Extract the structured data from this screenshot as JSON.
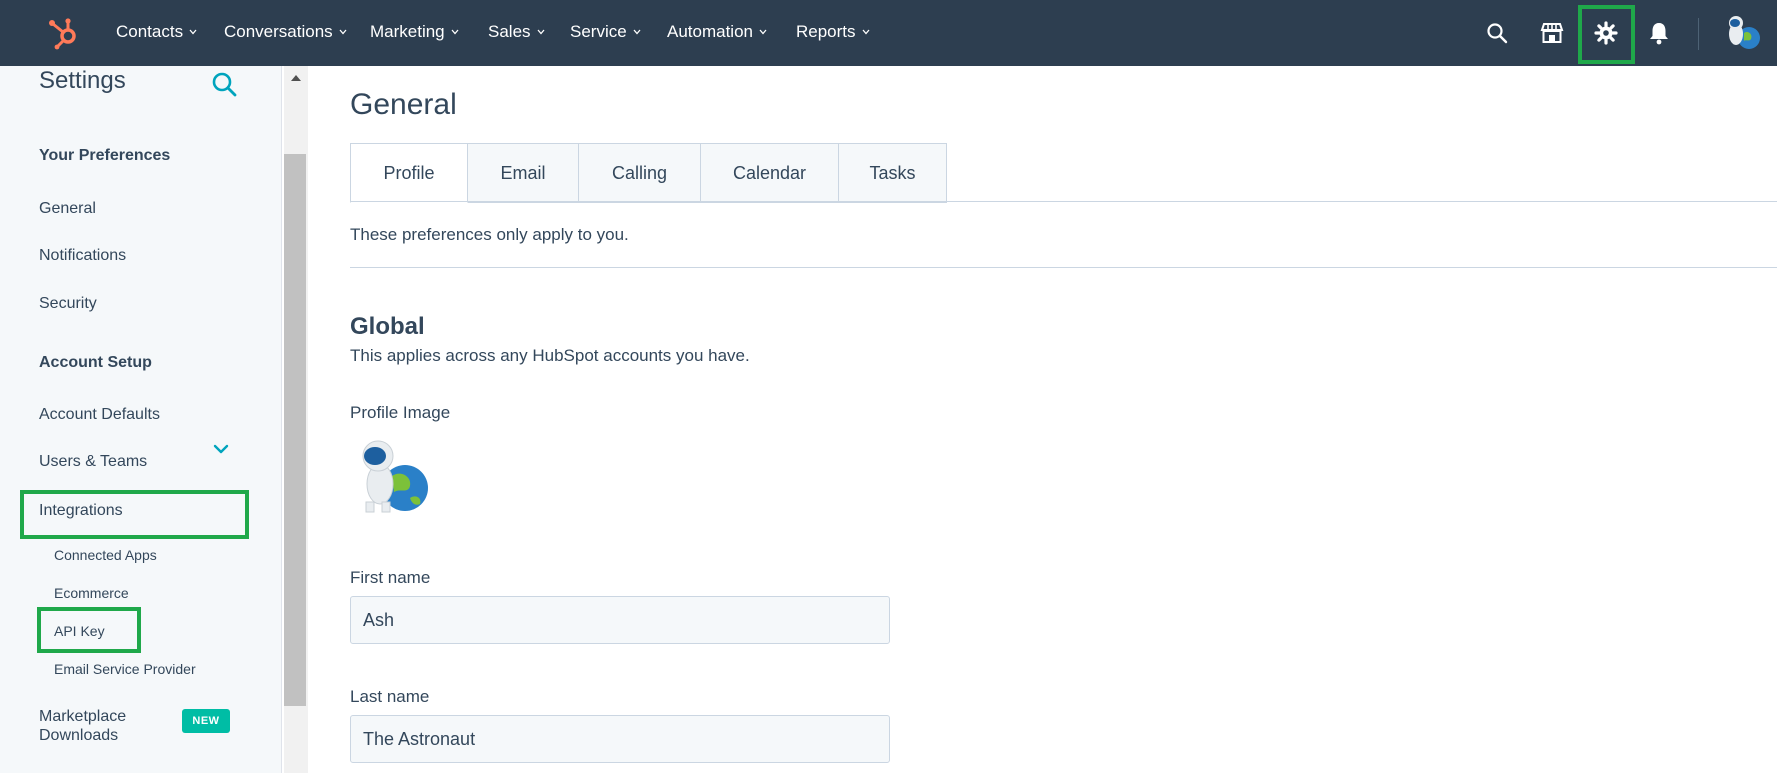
{
  "nav": {
    "items": [
      {
        "label": "Contacts"
      },
      {
        "label": "Conversations"
      },
      {
        "label": "Marketing"
      },
      {
        "label": "Sales"
      },
      {
        "label": "Service"
      },
      {
        "label": "Automation"
      },
      {
        "label": "Reports"
      }
    ],
    "icons": [
      "hubspot-logo-icon",
      "search-icon",
      "marketplace-icon",
      "gear-icon",
      "bell-icon"
    ],
    "brand_color": "#ff7a59",
    "bar_color": "#2d3e50"
  },
  "sidebar": {
    "title": "Settings",
    "sections": [
      {
        "heading": "Your Preferences",
        "items": [
          "General",
          "Notifications",
          "Security"
        ]
      },
      {
        "heading": "Account Setup",
        "items": [
          "Account Defaults",
          "Users & Teams",
          "Integrations"
        ]
      }
    ],
    "integrations_sub": [
      "Connected Apps",
      "Ecommerce",
      "API Key",
      "Email Service Provider"
    ],
    "marketplace": {
      "label_line1": "Marketplace",
      "label_line2": "Downloads",
      "badge": "NEW"
    },
    "accent_color": "#00a4bd",
    "badge_color": "#00bda5"
  },
  "main": {
    "title": "General",
    "tabs": [
      {
        "label": "Profile",
        "active": true
      },
      {
        "label": "Email"
      },
      {
        "label": "Calling"
      },
      {
        "label": "Calendar"
      },
      {
        "label": "Tasks"
      }
    ],
    "note": "These preferences only apply to you.",
    "global": {
      "title": "Global",
      "description": "This applies across any HubSpot accounts you have."
    },
    "profile_image_label": "Profile Image",
    "first_name": {
      "label": "First name",
      "value": "Ash"
    },
    "last_name": {
      "label": "Last name",
      "value": "The Astronaut"
    }
  },
  "highlight_color": "#1fa84a"
}
